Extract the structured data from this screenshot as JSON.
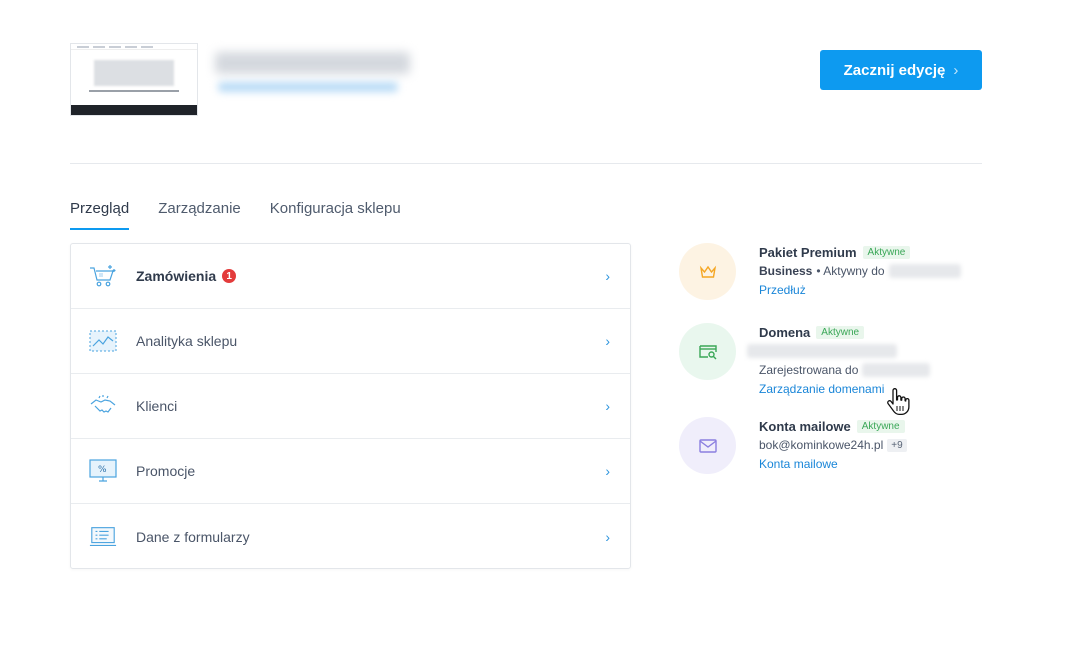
{
  "header": {
    "start_button_label": "Zacznij edycję",
    "start_button_chevron": "›"
  },
  "tabs": [
    {
      "label": "Przegląd",
      "active": true
    },
    {
      "label": "Zarządzanie",
      "active": false
    },
    {
      "label": "Konfiguracja sklepu",
      "active": false
    }
  ],
  "menu": {
    "items": [
      {
        "label": "Zamówienia",
        "badge": "1",
        "icon": "cart-icon"
      },
      {
        "label": "Analityka sklepu",
        "icon": "analytics-chart-icon"
      },
      {
        "label": "Klienci",
        "icon": "handshake-icon"
      },
      {
        "label": "Promocje",
        "icon": "percent-monitor-icon"
      },
      {
        "label": "Dane z formularzy",
        "icon": "form-laptop-icon"
      }
    ],
    "arrow": "›"
  },
  "services": {
    "premium": {
      "title": "Pakiet Premium",
      "status": "Aktywne",
      "plan": "Business",
      "plan_detail": "• Aktywny do",
      "link": "Przedłuż",
      "icon": "crown-icon",
      "color": "#f5a623"
    },
    "domain": {
      "title": "Domena",
      "status": "Aktywne",
      "registered": "Zarejestrowana do",
      "link": "Zarządzanie domenami",
      "icon": "domain-search-icon",
      "color": "#3aa757"
    },
    "mail": {
      "title": "Konta mailowe",
      "status": "Aktywne",
      "address": "bok@kominkowe24h.pl",
      "more": "+9",
      "link": "Konta mailowe",
      "icon": "envelope-icon",
      "color": "#8b7fe0"
    }
  },
  "colors": {
    "accent": "#0d9af0",
    "link": "#1a86d8",
    "badge": "#e33b3b",
    "active_status": "#3aa757"
  }
}
